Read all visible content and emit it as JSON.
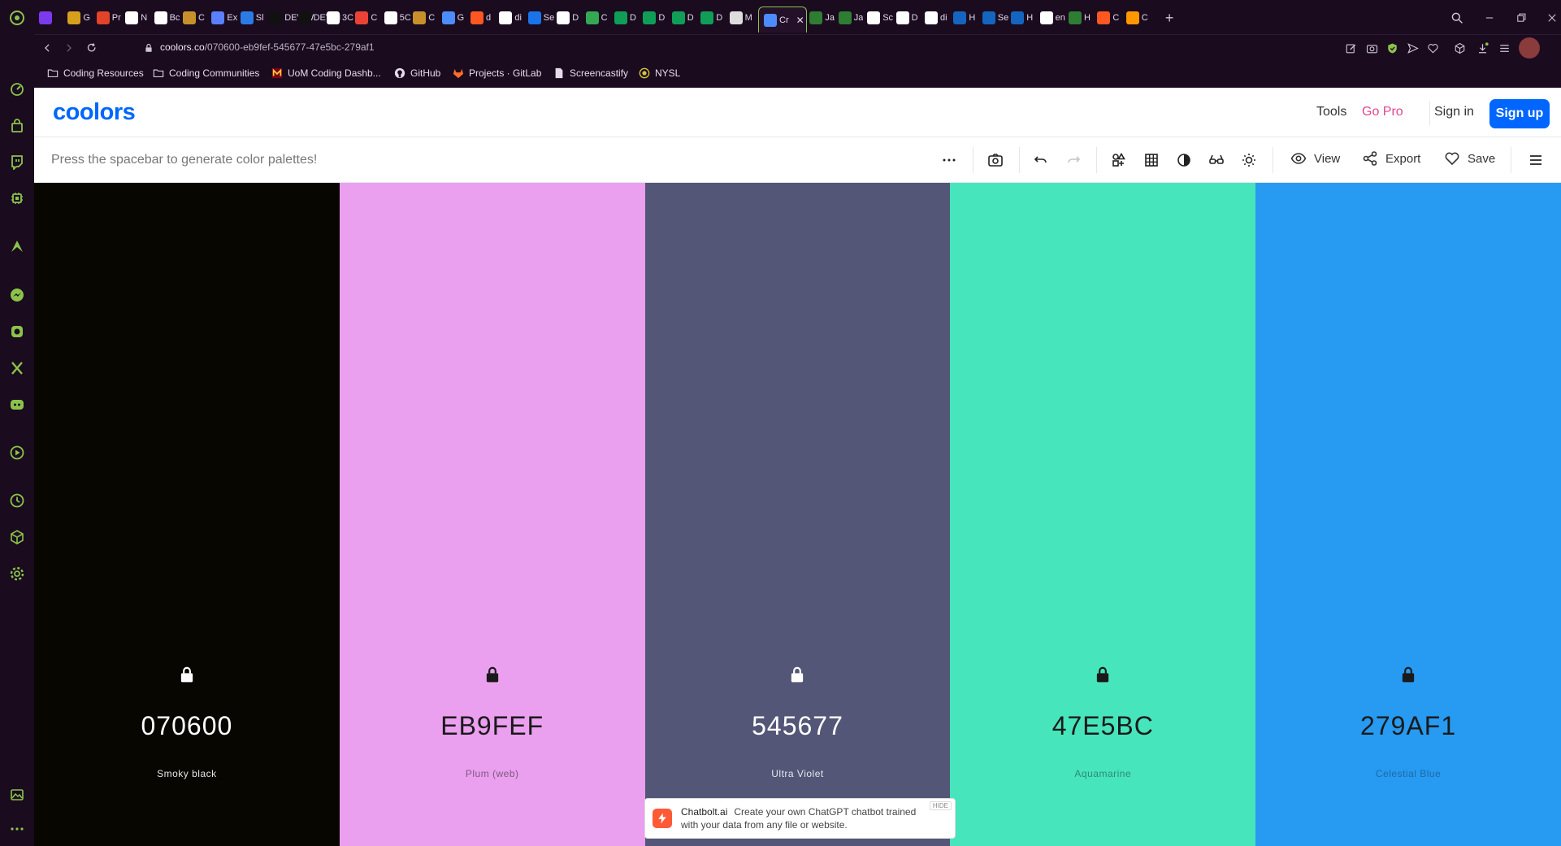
{
  "browser": {
    "tabs": [
      {
        "label": "",
        "color": "#7c3aed"
      },
      {
        "label": "G",
        "color": "#d6a01d"
      },
      {
        "label": "Pr",
        "color": "#e24329"
      },
      {
        "label": "N",
        "color": "#ffffff"
      },
      {
        "label": "Bc",
        "color": "#ffffff"
      },
      {
        "label": "C",
        "color": "#c7902b"
      },
      {
        "label": "Ex",
        "color": "#5b7fff"
      },
      {
        "label": "Sl",
        "color": "#2c7be5"
      },
      {
        "label": "DEV W",
        "color": "#111111"
      },
      {
        "label": "DEV H",
        "color": "#111111"
      },
      {
        "label": "3C",
        "color": "#ffffff"
      },
      {
        "label": "C",
        "color": "#ea4335"
      },
      {
        "label": "5C",
        "color": "#ffffff"
      },
      {
        "label": "C",
        "color": "#c7902b"
      },
      {
        "label": "G",
        "color": "#4d8cff"
      },
      {
        "label": "d",
        "color": "#ff5722"
      },
      {
        "label": "di",
        "color": "#ffffff"
      },
      {
        "label": "Se",
        "color": "#1a73e8"
      },
      {
        "label": "D",
        "color": "#ffffff"
      },
      {
        "label": "C",
        "color": "#34a853"
      },
      {
        "label": "D",
        "color": "#0f9d58"
      },
      {
        "label": "D",
        "color": "#0f9d58"
      },
      {
        "label": "D",
        "color": "#0f9d58"
      },
      {
        "label": "D",
        "color": "#0f9d58"
      },
      {
        "label": "M",
        "color": "#dddddd"
      },
      {
        "label": "Cr",
        "color": "#4d8cff"
      },
      {
        "label": "Ja",
        "color": "#2e7d32"
      },
      {
        "label": "Ja",
        "color": "#2e7d32"
      },
      {
        "label": "Sc",
        "color": "#ffffff"
      },
      {
        "label": "D",
        "color": "#ffffff"
      },
      {
        "label": "di",
        "color": "#ffffff"
      },
      {
        "label": "H",
        "color": "#1565c0"
      },
      {
        "label": "Se",
        "color": "#1565c0"
      },
      {
        "label": "H",
        "color": "#1565c0"
      },
      {
        "label": "en",
        "color": "#ffffff"
      },
      {
        "label": "H",
        "color": "#2e7d32"
      },
      {
        "label": "C",
        "color": "#ff5722"
      },
      {
        "label": "C",
        "color": "#ff9800"
      }
    ],
    "active_tab_index": 25,
    "new_tab_label": "+",
    "url_host": "coolors.co",
    "url_path": "/070600-eb9fef-545677-47e5bc-279af1",
    "bookmarks": [
      {
        "label": "Coding Resources",
        "icon": "folder-icon"
      },
      {
        "label": "Coding Communities",
        "icon": "folder-icon"
      },
      {
        "label": "UoM Coding Dashb...",
        "icon": "umn-logo-icon"
      },
      {
        "label": "GitHub",
        "icon": "github-icon"
      },
      {
        "label": "Projects · GitLab",
        "icon": "gitlab-icon"
      },
      {
        "label": "Screencastify",
        "icon": "document-icon"
      },
      {
        "label": "NYSL",
        "icon": "nysl-icon"
      }
    ]
  },
  "site": {
    "logo": "coolors",
    "nav": {
      "tools": "Tools",
      "go_pro": "Go Pro",
      "sign_in": "Sign in",
      "sign_up": "Sign up"
    },
    "toolbar": {
      "hint": "Press the spacebar to generate color palettes!",
      "view": "View",
      "export": "Export",
      "save": "Save"
    },
    "palette": [
      {
        "hex": "070600",
        "name": "Smoky black",
        "bg": "#070600",
        "fg": "#ffffff",
        "label_color": "#e6e6e6"
      },
      {
        "hex": "EB9FEF",
        "name": "Plum (web)",
        "bg": "#eb9fef",
        "fg": "#1a1a1a",
        "label_color": "#7c5a80"
      },
      {
        "hex": "545677",
        "name": "Ultra Violet",
        "bg": "#545677",
        "fg": "#ffffff",
        "label_color": "#e6e6ee"
      },
      {
        "hex": "47E5BC",
        "name": "Aquamarine",
        "bg": "#47e5bc",
        "fg": "#1a1a1a",
        "label_color": "#2f8a72"
      },
      {
        "hex": "279AF1",
        "name": "Celestial Blue",
        "bg": "#279af1",
        "fg": "#1a1a1a",
        "label_color": "#1d6aa6"
      }
    ],
    "ad": {
      "brand": "Chatbolt.ai",
      "text": "Create your own ChatGPT chatbot trained with your data from any file or website.",
      "hide": "HIDE"
    }
  }
}
